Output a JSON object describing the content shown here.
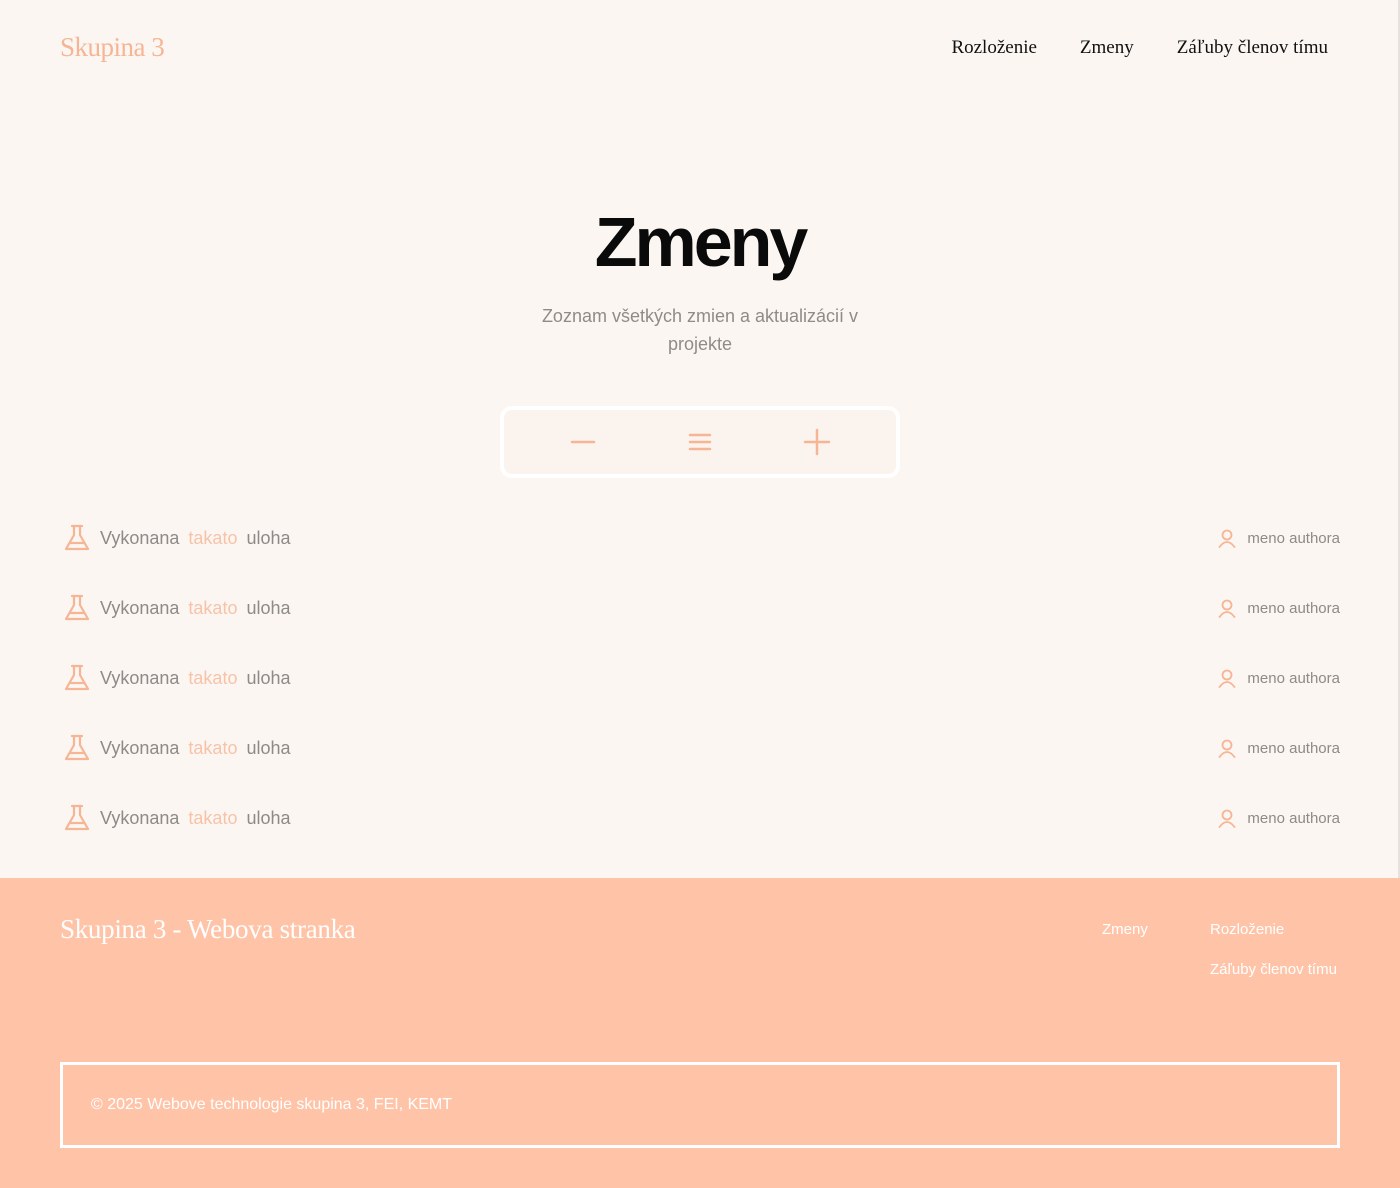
{
  "header": {
    "brand": "Skupina 3",
    "nav": [
      "Rozloženie",
      "Zmeny",
      "Záľuby členov tímu"
    ]
  },
  "hero": {
    "title": "Zmeny",
    "subtitle": "Zoznam všetkých zmien a aktualizácií v projekte"
  },
  "toolbar": {
    "buttons": [
      "minus-icon",
      "menu-icon",
      "plus-icon"
    ]
  },
  "changes": [
    {
      "prefix": "Vykonana",
      "highlight": "takato",
      "suffix": "uloha",
      "author": "meno authora"
    },
    {
      "prefix": "Vykonana",
      "highlight": "takato",
      "suffix": "uloha",
      "author": "meno authora"
    },
    {
      "prefix": "Vykonana",
      "highlight": "takato",
      "suffix": "uloha",
      "author": "meno authora"
    },
    {
      "prefix": "Vykonana",
      "highlight": "takato",
      "suffix": "uloha",
      "author": "meno authora"
    },
    {
      "prefix": "Vykonana",
      "highlight": "takato",
      "suffix": "uloha",
      "author": "meno authora"
    }
  ],
  "footer": {
    "title": "Skupina 3 - Webova stranka",
    "links": [
      "Zmeny",
      "Rozloženie",
      "Záľuby členov tímu"
    ],
    "copyright": "© 2025 Webove technologie skupina 3, FEI, KEMT"
  },
  "colors": {
    "accent": "#f6b594",
    "footer_bg": "#ffc4a8",
    "background": "#fbf6f2"
  }
}
